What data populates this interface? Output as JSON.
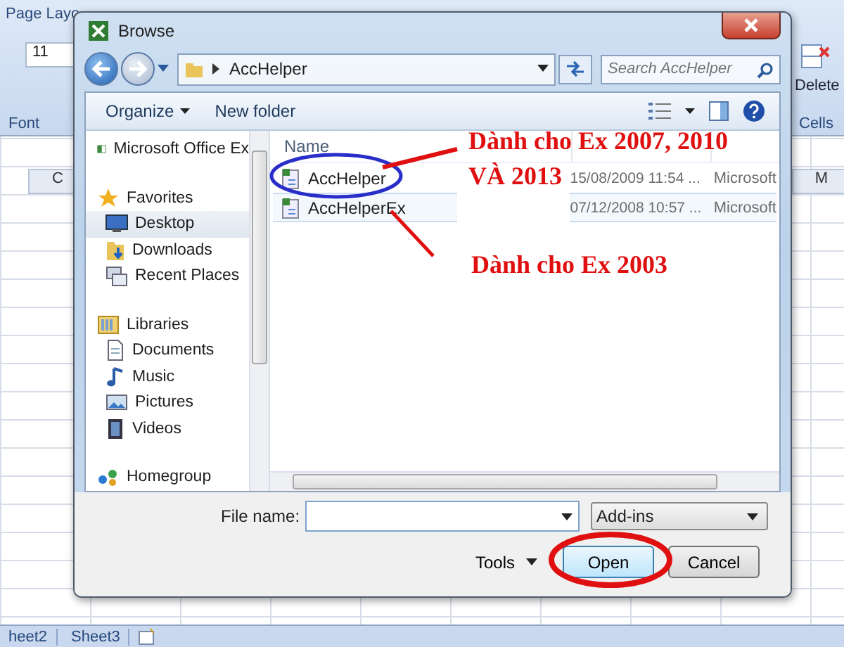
{
  "excel": {
    "ribbon_tab": "Page Layo",
    "font_size": "11",
    "font_group": "Font",
    "delete_label": "Delete",
    "cells_group": "Cells",
    "column_headers": [
      "C",
      "M"
    ],
    "sheet_tabs": [
      {
        "label": "heet2"
      },
      {
        "label": "Sheet3"
      }
    ]
  },
  "dialog": {
    "title": "Browse",
    "address": "AccHelper",
    "search_placeholder": "Search AccHelper",
    "organize": "Organize",
    "new_folder": "New folder",
    "nav": [
      {
        "kind": "excel",
        "label": "Microsoft Office Ex",
        "selected": false
      },
      {
        "kind": "favorites",
        "label": "Favorites",
        "selected": false
      },
      {
        "kind": "desktop",
        "label": "Desktop",
        "selected": true
      },
      {
        "kind": "downloads",
        "label": "Downloads",
        "selected": false
      },
      {
        "kind": "recent",
        "label": "Recent Places",
        "selected": false
      },
      {
        "kind": "libraries",
        "label": "Libraries",
        "selected": false
      },
      {
        "kind": "documents",
        "label": "Documents",
        "selected": false
      },
      {
        "kind": "music",
        "label": "Music",
        "selected": false
      },
      {
        "kind": "pictures",
        "label": "Pictures",
        "selected": false
      },
      {
        "kind": "videos",
        "label": "Videos",
        "selected": false
      },
      {
        "kind": "homegroup",
        "label": "Homegroup",
        "selected": false
      }
    ],
    "column_name": "Name",
    "files": [
      {
        "name": "AccHelper",
        "date": "15/08/2009 11:54 ...",
        "type": "Microsoft",
        "selected": false
      },
      {
        "name": "AccHelperEx",
        "date": "07/12/2008 10:57 ...",
        "type": "Microsoft",
        "selected": true
      }
    ],
    "file_name_label": "File name:",
    "file_type": "Add-ins",
    "tools": "Tools",
    "open": "Open",
    "cancel": "Cancel"
  },
  "annotations": [
    {
      "kind": "text",
      "lines": [
        "Dành cho Ex 2007, 2010",
        "VÀ 2013"
      ]
    },
    {
      "kind": "text",
      "lines": [
        "Dành cho Ex 2003"
      ]
    }
  ]
}
